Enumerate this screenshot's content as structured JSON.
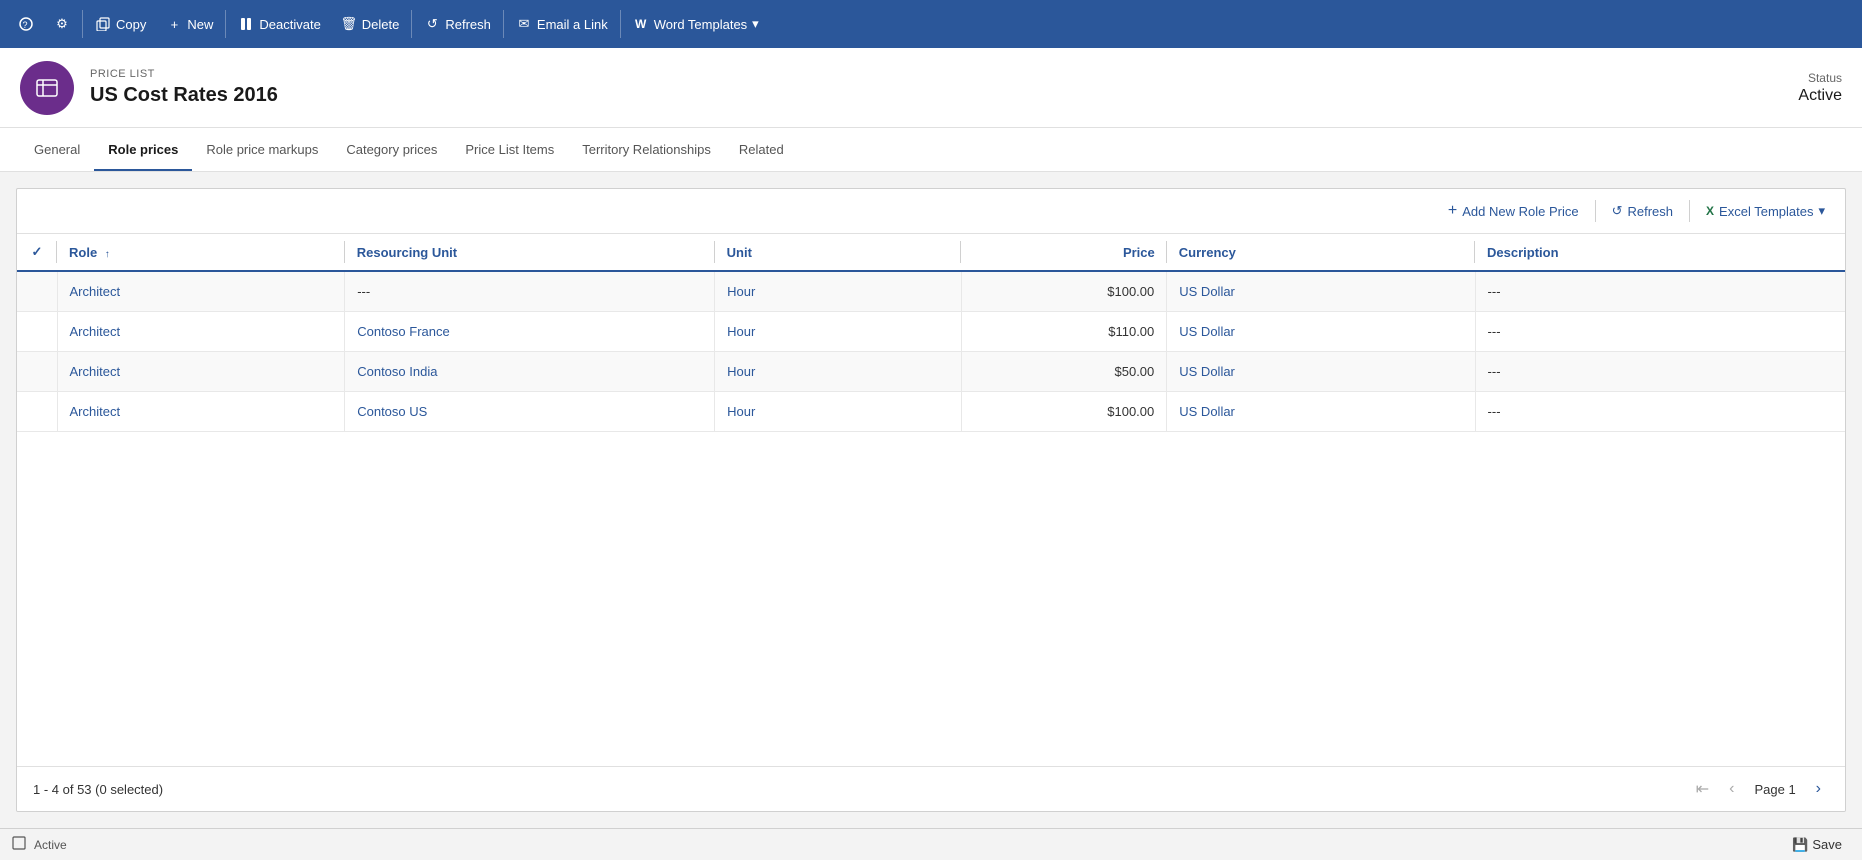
{
  "toolbar": {
    "back_icon": "←",
    "settings_icon": "⚙",
    "copy_label": "Copy",
    "new_label": "New",
    "deactivate_label": "Deactivate",
    "delete_label": "Delete",
    "refresh_label": "Refresh",
    "email_label": "Email a Link",
    "word_templates_label": "Word Templates"
  },
  "entity": {
    "type": "PRICE LIST",
    "title": "US Cost Rates 2016",
    "status_label": "Status",
    "status_value": "Active"
  },
  "tabs": [
    {
      "id": "general",
      "label": "General",
      "active": false
    },
    {
      "id": "role-prices",
      "label": "Role prices",
      "active": true
    },
    {
      "id": "role-price-markups",
      "label": "Role price markups",
      "active": false
    },
    {
      "id": "category-prices",
      "label": "Category prices",
      "active": false
    },
    {
      "id": "price-list-items",
      "label": "Price List Items",
      "active": false
    },
    {
      "id": "territory-relationships",
      "label": "Territory Relationships",
      "active": false
    },
    {
      "id": "related",
      "label": "Related",
      "active": false
    }
  ],
  "grid": {
    "add_new_label": "Add New Role Price",
    "refresh_label": "Refresh",
    "excel_templates_label": "Excel Templates",
    "columns": [
      {
        "id": "check",
        "label": ""
      },
      {
        "id": "role",
        "label": "Role",
        "sortable": true
      },
      {
        "id": "resourcing-unit",
        "label": "Resourcing Unit"
      },
      {
        "id": "unit",
        "label": "Unit"
      },
      {
        "id": "price",
        "label": "Price"
      },
      {
        "id": "currency",
        "label": "Currency"
      },
      {
        "id": "description",
        "label": "Description"
      }
    ],
    "rows": [
      {
        "role": "Architect",
        "resourcing_unit": "---",
        "unit": "Hour",
        "price": "$100.00",
        "currency": "US Dollar",
        "description": "---"
      },
      {
        "role": "Architect",
        "resourcing_unit": "Contoso France",
        "unit": "Hour",
        "price": "$110.00",
        "currency": "US Dollar",
        "description": "---"
      },
      {
        "role": "Architect",
        "resourcing_unit": "Contoso India",
        "unit": "Hour",
        "price": "$50.00",
        "currency": "US Dollar",
        "description": "---"
      },
      {
        "role": "Architect",
        "resourcing_unit": "Contoso US",
        "unit": "Hour",
        "price": "$100.00",
        "currency": "US Dollar",
        "description": "---"
      }
    ],
    "pagination": {
      "info": "1 - 4 of 53 (0 selected)",
      "page_label": "Page 1"
    }
  },
  "status_bar": {
    "status": "Active",
    "save_label": "Save"
  }
}
